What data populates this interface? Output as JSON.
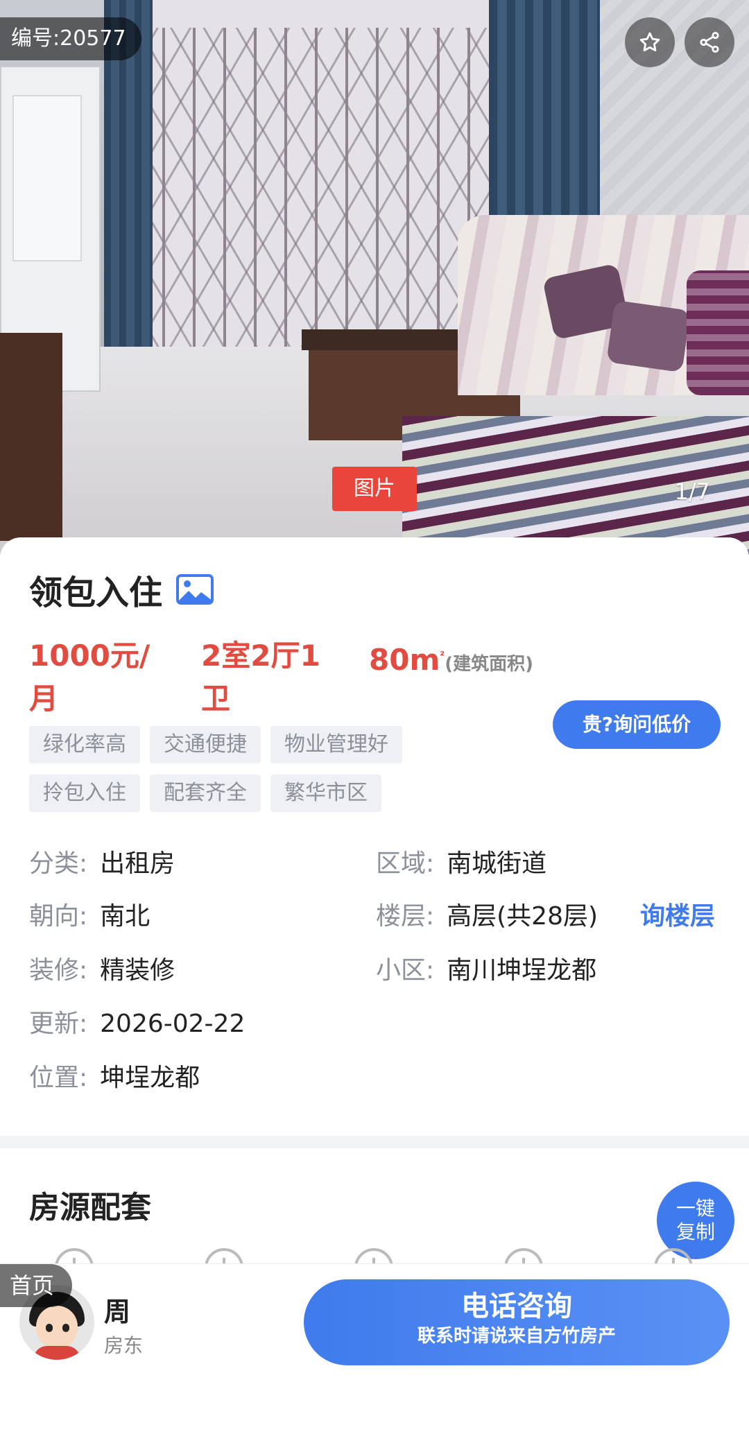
{
  "gallery": {
    "listing_id": "编号:20577",
    "image_tag": "图片",
    "counter": "1/7"
  },
  "listing": {
    "title": "领包入住",
    "price": "1000元/月",
    "layout": "2室2厅1卫",
    "area_value": "80m",
    "area_unit_sup": "²",
    "area_note": "(建筑面积)",
    "ask_button": "贵?询问低价",
    "tags": [
      "绿化率高",
      "交通便捷",
      "物业管理好",
      "拎包入住",
      "配套齐全",
      "繁华市区"
    ],
    "info": {
      "category": {
        "key": "分类:",
        "value": "出租房"
      },
      "region": {
        "key": "区域:",
        "value": "南城街道"
      },
      "orientation": {
        "key": "朝向:",
        "value": "南北"
      },
      "floor": {
        "key": "楼层:",
        "value": "高层(共28层)"
      },
      "decoration": {
        "key": "装修:",
        "value": "精装修"
      },
      "community": {
        "key": "小区:",
        "value": "南川坤埕龙都"
      },
      "updated": {
        "key": "更新:",
        "value": "2026-02-22"
      },
      "location": {
        "key": "位置:",
        "value": "坤埕龙都"
      }
    },
    "floor_link": "询楼层"
  },
  "amenities": {
    "title": "房源配套",
    "copy_line1": "一键",
    "copy_line2": "复制"
  },
  "bottom": {
    "home_label": "首页",
    "owner_name": "周",
    "owner_role": "房东",
    "call_label": "电话咨询",
    "call_sub": "联系时请说来自方竹房产"
  },
  "colors": {
    "accent_blue": "#3f7bec",
    "price_red": "#e14b40",
    "image_tag_red": "#e8463d",
    "tag_bg": "#eef0f3"
  }
}
